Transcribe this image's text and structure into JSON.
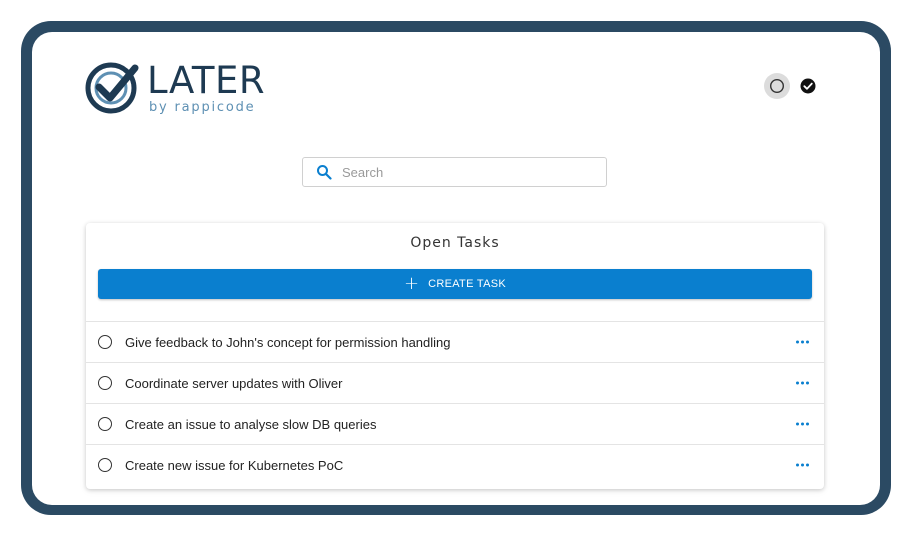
{
  "app": {
    "logo_word": "LATER",
    "logo_subtitle": "by rappicode",
    "brand_color": "#1e3a52",
    "accent_color": "#0a7fcf"
  },
  "header": {
    "filter_open_icon": "circle-outline-icon",
    "filter_done_icon": "check-circle-icon"
  },
  "search": {
    "placeholder": "Search",
    "value": "",
    "icon": "search-icon"
  },
  "tasks_panel": {
    "title": "Open Tasks",
    "create_label": "CREATE TASK",
    "create_icon": "plus-icon",
    "items": [
      {
        "label": "Give feedback to John's concept for permission handling"
      },
      {
        "label": "Coordinate server updates with Oliver"
      },
      {
        "label": "Create an issue to analyse slow DB queries"
      },
      {
        "label": "Create new issue for Kubernetes PoC"
      }
    ]
  }
}
